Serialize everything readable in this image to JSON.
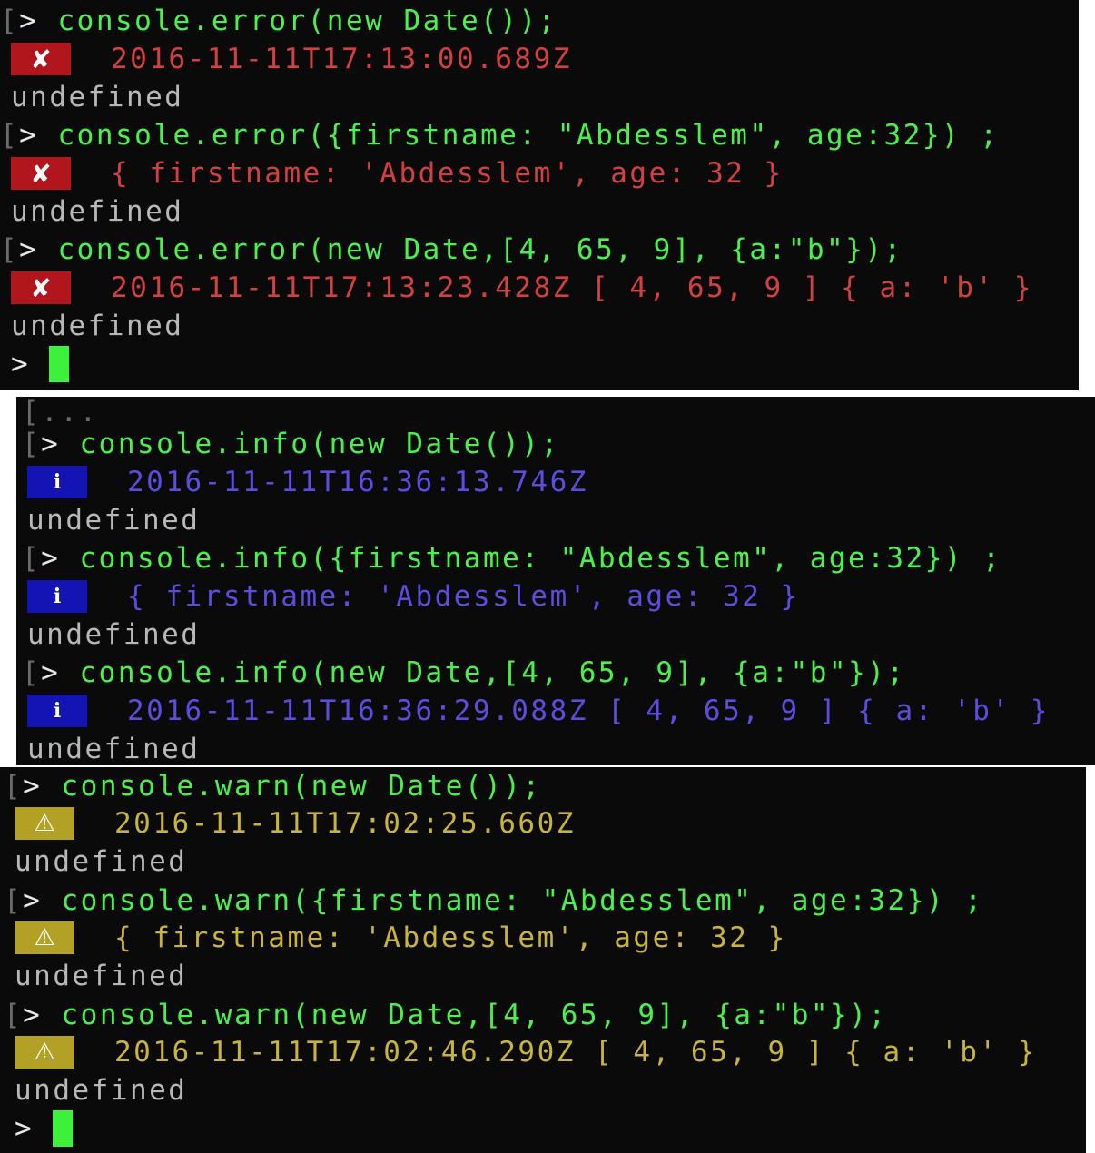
{
  "colors": {
    "background": "#0a0a0a",
    "command": "#4cf04c",
    "error_text": "#d24040",
    "error_badge": "#b0161c",
    "info_text": "#5a4de0",
    "info_badge": "#1414b4",
    "warn_text": "#c9b43a",
    "warn_badge": "#b3a126",
    "undefined_text": "#b8b8b8",
    "cursor": "#3cf03c"
  },
  "prompt": ">",
  "error_panel": {
    "badge_icon": "cross-icon",
    "badge_glyph": "✘",
    "entries": [
      {
        "command": "console.error(new Date());",
        "output": "2016-11-11T17:13:00.689Z",
        "result": "undefined"
      },
      {
        "command": "console.error({firstname: \"Abdesslem\", age:32}) ;",
        "output": "{ firstname: 'Abdesslem', age: 32 }",
        "result": "undefined"
      },
      {
        "command": "console.error(new Date,[4, 65, 9], {a:\"b\"});",
        "output": "2016-11-11T17:13:23.428Z [ 4, 65, 9 ] { a: 'b' }",
        "result": "undefined"
      }
    ]
  },
  "info_panel": {
    "ellipsis": "...",
    "badge_icon": "info-icon",
    "badge_glyph": "i",
    "entries": [
      {
        "command": "console.info(new Date());",
        "output": "2016-11-11T16:36:13.746Z",
        "result": "undefined"
      },
      {
        "command": "console.info({firstname: \"Abdesslem\", age:32}) ;",
        "output": "{ firstname: 'Abdesslem', age: 32 }",
        "result": "undefined"
      },
      {
        "command": "console.info(new Date,[4, 65, 9], {a:\"b\"});",
        "output": "2016-11-11T16:36:29.088Z [ 4, 65, 9 ] { a: 'b' }",
        "result": "undefined"
      }
    ]
  },
  "warn_panel": {
    "badge_icon": "warning-icon",
    "badge_glyph": "⚠",
    "entries": [
      {
        "command": "console.warn(new Date());",
        "output": "2016-11-11T17:02:25.660Z",
        "result": "undefined"
      },
      {
        "command": "console.warn({firstname: \"Abdesslem\", age:32}) ;",
        "output": "{ firstname: 'Abdesslem', age: 32 }",
        "result": "undefined"
      },
      {
        "command": "console.warn(new Date,[4, 65, 9], {a:\"b\"});",
        "output": "2016-11-11T17:02:46.290Z [ 4, 65, 9 ] { a: 'b' }",
        "result": "undefined"
      }
    ]
  }
}
